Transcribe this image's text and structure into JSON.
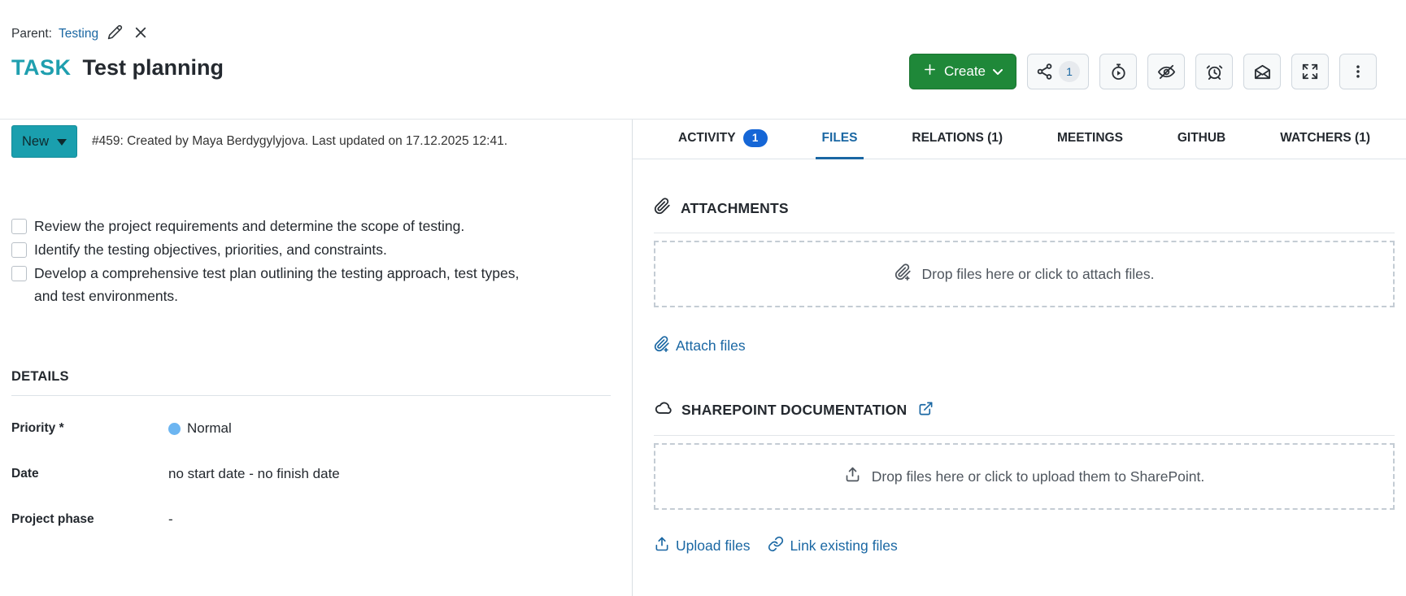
{
  "header": {
    "parent_label": "Parent:",
    "parent_link": "Testing",
    "type_label": "TASK",
    "title": "Test planning",
    "create_label": "Create",
    "share_count": "1"
  },
  "status": {
    "label": "New",
    "meta": "#459: Created by Maya Berdygylyjova. Last updated on 17.12.2025 12:41."
  },
  "checklist": [
    {
      "label": "Review the project requirements and determine the scope of testing.",
      "checked": false
    },
    {
      "label": "Identify the testing objectives, priorities, and constraints.",
      "checked": false
    },
    {
      "label": "Develop a comprehensive test plan outlining the testing approach, test types, and test environments.",
      "checked": false
    }
  ],
  "details": {
    "heading": "DETAILS",
    "fields": [
      {
        "label": "Priority *",
        "value": "Normal"
      },
      {
        "label": "Date",
        "value": "no start date - no finish date"
      },
      {
        "label": "Project phase",
        "value": "-"
      }
    ]
  },
  "tabs": [
    {
      "label": "ACTIVITY",
      "badge": "1"
    },
    {
      "label": "FILES"
    },
    {
      "label": "RELATIONS (1)"
    },
    {
      "label": "MEETINGS"
    },
    {
      "label": "GITHUB"
    },
    {
      "label": "WATCHERS (1)"
    }
  ],
  "attachments": {
    "heading": "ATTACHMENTS",
    "dropzone_text": "Drop files here or click to attach files.",
    "attach_link": "Attach files"
  },
  "sharepoint": {
    "heading": "SHAREPOINT DOCUMENTATION",
    "dropzone_text": "Drop files here or click to upload them to SharePoint.",
    "upload_link": "Upload files",
    "link_existing_link": "Link existing files"
  },
  "colors": {
    "accent_teal": "#1a9fae",
    "accent_green": "#1f8839",
    "link_blue": "#1a67a3",
    "badge_blue": "#1566d6",
    "priority_dot_blue": "#6cb5f1"
  }
}
